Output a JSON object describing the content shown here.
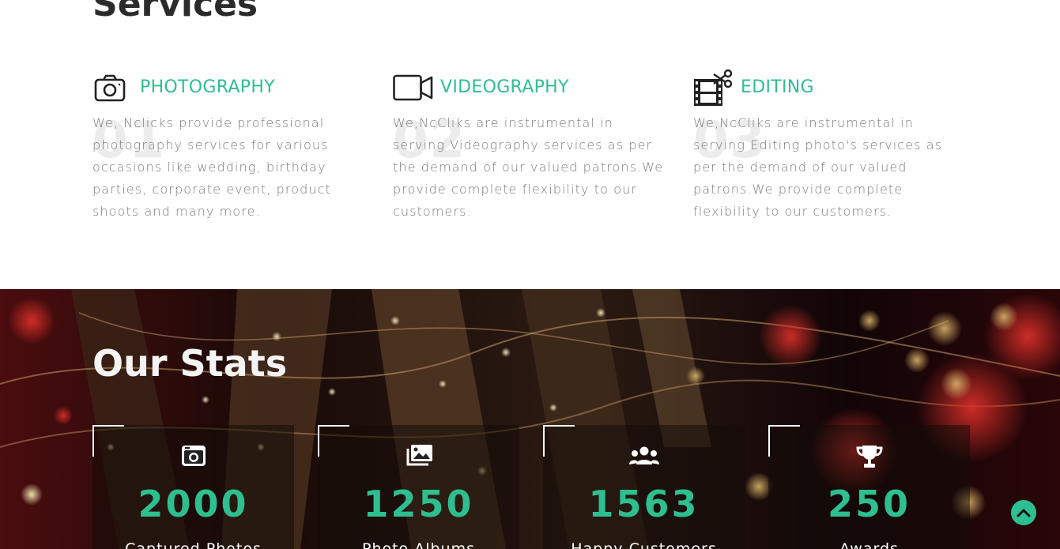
{
  "services": {
    "title": "Services",
    "items": [
      {
        "icon": "camera-icon",
        "name": "PHOTOGRAPHY",
        "number": "01",
        "description": "We, Nclicks provide professional photography services for various occasions like wedding, birthday parties, corporate event, product shoots and many more."
      },
      {
        "icon": "video-camera-icon",
        "name": "VIDEOGRAPHY",
        "number": "02",
        "description": "We,NcCliks are instrumental in serving Videography services as per the demand of our valued patrons.We provide complete flexibility to our customers."
      },
      {
        "icon": "film-editing-icon",
        "name": "EDITING",
        "number": "03",
        "description": "We,NcCliks are instrumental in serving Editing photo's services as per the demand of our valued patrons.We provide complete flexibility to our customers."
      }
    ]
  },
  "stats": {
    "title": "Our Stats",
    "items": [
      {
        "icon": "camera-icon",
        "number": "2000",
        "label": "Captured Photos"
      },
      {
        "icon": "photo-album-icon",
        "number": "1250",
        "label": "Photo Albums"
      },
      {
        "icon": "users-icon",
        "number": "1563",
        "label": "Happy Customers"
      },
      {
        "icon": "trophy-icon",
        "number": "250",
        "label": "Awards"
      }
    ]
  },
  "colors": {
    "accent": "#2ebf91",
    "heading": "#2b2b2b",
    "body_text": "#7a7a7a"
  },
  "scroll_top_icon": "chevron-up-icon"
}
